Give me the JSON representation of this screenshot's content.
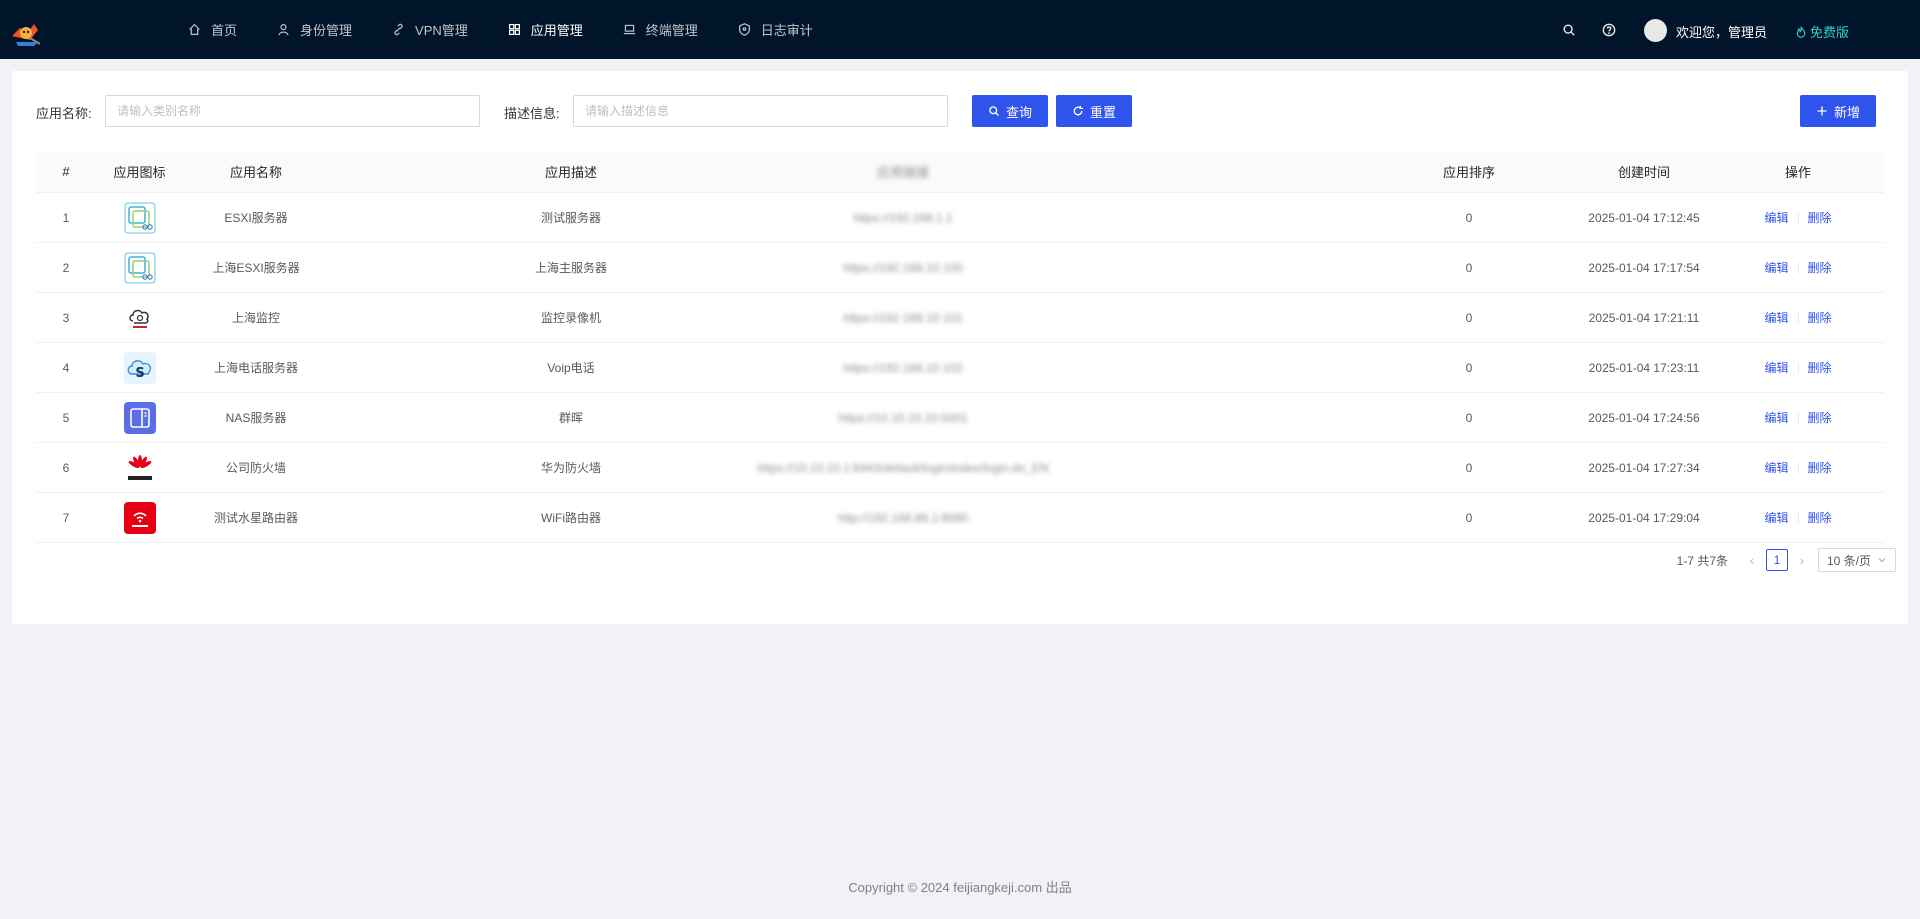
{
  "nav": {
    "items": [
      {
        "label": "首页",
        "icon": "home-icon"
      },
      {
        "label": "身份管理",
        "icon": "user-icon"
      },
      {
        "label": "VPN管理",
        "icon": "link-icon"
      },
      {
        "label": "应用管理",
        "icon": "apps-icon",
        "active": true
      },
      {
        "label": "终端管理",
        "icon": "laptop-icon"
      },
      {
        "label": "日志审计",
        "icon": "shield-icon"
      }
    ]
  },
  "header": {
    "welcome": "欢迎您，管理员",
    "plan": "免费版"
  },
  "filters": {
    "name_label": "应用名称:",
    "name_placeholder": "请输入类别名称",
    "desc_label": "描述信息:",
    "desc_placeholder": "请输入描述信息",
    "query_label": "查询",
    "reset_label": "重置",
    "add_label": "新增"
  },
  "table": {
    "columns": [
      "#",
      "应用图标",
      "应用名称",
      "应用描述",
      "应用链接",
      "应用排序",
      "创建时间",
      "操作"
    ],
    "rows": [
      {
        "index": "1",
        "icon": "esxi-icon",
        "name": "ESXI服务器",
        "desc": "测试服务器",
        "url": "https://192.168.1.1",
        "sort": "0",
        "created": "2025-01-04 17:12:45"
      },
      {
        "index": "2",
        "icon": "esxi-icon",
        "name": "上海ESXI服务器",
        "desc": "上海主服务器",
        "url": "https://192.168.10.100",
        "sort": "0",
        "created": "2025-01-04 17:17:54"
      },
      {
        "index": "3",
        "icon": "hikvision-cloud-icon",
        "name": "上海监控",
        "desc": "监控录像机",
        "url": "https://192.168.10.101",
        "sort": "0",
        "created": "2025-01-04 17:21:11"
      },
      {
        "index": "4",
        "icon": "voip-cloud-icon",
        "name": "上海电话服务器",
        "desc": "Voip电话",
        "url": "https://192.168.10.102",
        "sort": "0",
        "created": "2025-01-04 17:23:11"
      },
      {
        "index": "5",
        "icon": "nas-icon",
        "name": "NAS服务器",
        "desc": "群晖",
        "url": "https://10.10.10.10:5001",
        "sort": "0",
        "created": "2025-01-04 17:24:56"
      },
      {
        "index": "6",
        "icon": "huawei-icon",
        "name": "公司防火墙",
        "desc": "华为防火墙",
        "url": "https://10.10.10.1:8443/default/login/index/login.do_EN",
        "sort": "0",
        "created": "2025-01-04 17:27:34"
      },
      {
        "index": "7",
        "icon": "router-icon",
        "name": "测试水星路由器",
        "desc": "WiFi路由器",
        "url": "http://192.168.88.1:8080",
        "sort": "0",
        "created": "2025-01-04 17:29:04"
      }
    ],
    "edit_label": "编辑",
    "delete_label": "删除"
  },
  "pagination": {
    "total_text": "1-7 共7条",
    "current_page": "1",
    "page_size": "10 条/页"
  },
  "footer": {
    "text": "Copyright © 2024 feijiangkeji.com 出品"
  },
  "colors": {
    "header_bg": "#001529",
    "primary": "#2f54eb",
    "plan": "#36cfc9"
  }
}
